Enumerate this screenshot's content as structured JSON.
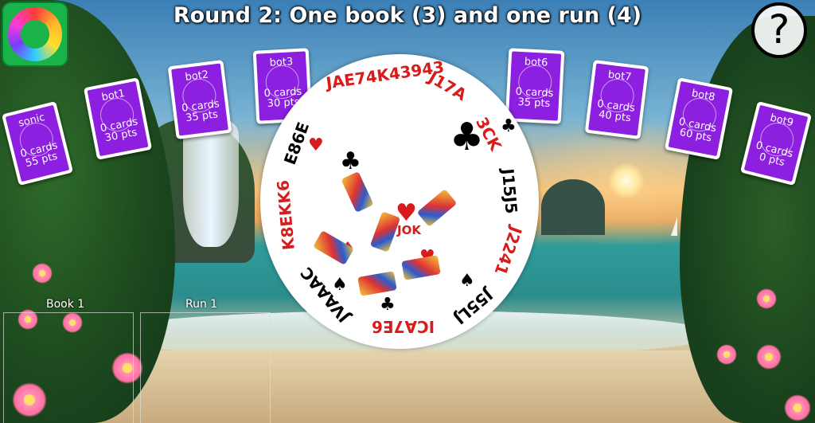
{
  "title": "Round 2: One book (3) and one run (4)",
  "help_button": "?",
  "players": [
    {
      "name": "sonic",
      "cards": "0 cards",
      "points": "55 pts"
    },
    {
      "name": "bot1",
      "cards": "0 cards",
      "points": "30 pts"
    },
    {
      "name": "bot2",
      "cards": "0 cards",
      "points": "35 pts"
    },
    {
      "name": "bot3",
      "cards": "0 cards",
      "points": "30 pts"
    },
    {
      "name": "bot6",
      "cards": "0 cards",
      "points": "35 pts"
    },
    {
      "name": "bot7",
      "cards": "0 cards",
      "points": "40 pts"
    },
    {
      "name": "bot8",
      "cards": "0 cards",
      "points": "60 pts"
    },
    {
      "name": "bot9",
      "cards": "0 cards",
      "points": "0 pts"
    }
  ],
  "meld_zones": {
    "book_label": "Book 1",
    "run_label": "Run 1"
  },
  "deal_circle": {
    "joker_label": "JOK",
    "rank_strings": [
      "JAE74K43943",
      "J17A",
      "3CK",
      "J15J5",
      "J2241",
      "J55LJ",
      "ICA7E6",
      "JVAAAC",
      "K8EKK6",
      "E86E"
    ]
  },
  "colors": {
    "card_back": "#8c1fe0",
    "red_suit": "#d81b1b",
    "black_suit": "#000000",
    "app_icon_green": "#19b34a"
  }
}
